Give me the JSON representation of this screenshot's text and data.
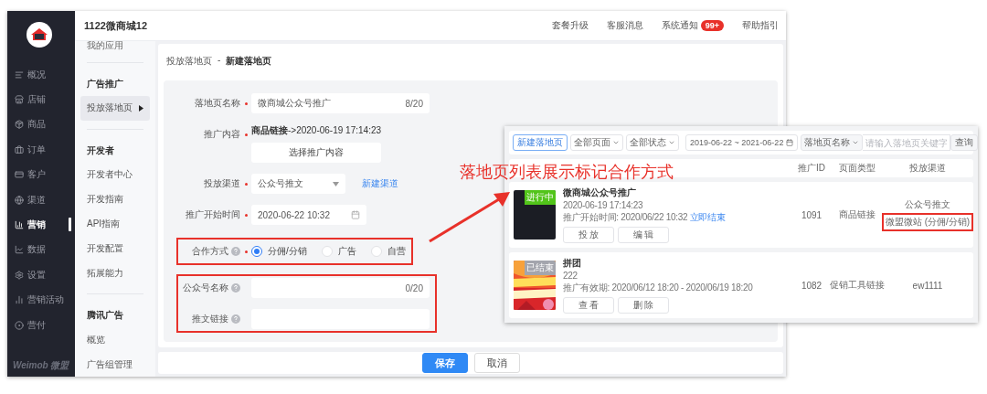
{
  "app": {
    "title": "1122微商城12",
    "brand": "Weimob 微盟"
  },
  "nav": [
    {
      "label": "概况",
      "selected": false
    },
    {
      "label": "店铺",
      "selected": false
    },
    {
      "label": "商品",
      "selected": false
    },
    {
      "label": "订单",
      "selected": false
    },
    {
      "label": "客户",
      "selected": false
    },
    {
      "label": "渠道",
      "selected": false
    },
    {
      "label": "营销",
      "selected": true
    },
    {
      "label": "数据",
      "selected": false
    },
    {
      "label": "设置",
      "selected": false
    },
    {
      "label": "营销活动",
      "selected": false
    },
    {
      "label": "营付",
      "selected": false
    }
  ],
  "top_links": [
    {
      "label": "套餐升级"
    },
    {
      "label": "客服消息"
    },
    {
      "label": "系统通知",
      "badge": "99+"
    },
    {
      "label": "帮助指引"
    }
  ],
  "subnav": {
    "top_item": "我的应用",
    "groups": [
      {
        "title": "广告推广",
        "items": [
          {
            "label": "投放落地页",
            "selected": true
          }
        ]
      },
      {
        "title": "开发者",
        "items": [
          {
            "label": "开发者中心",
            "selected": false
          },
          {
            "label": "开发指南",
            "selected": false
          },
          {
            "label": "API指南",
            "selected": false
          },
          {
            "label": "开发配置",
            "selected": false
          },
          {
            "label": "拓展能力",
            "selected": false
          }
        ]
      },
      {
        "title": "腾讯广告",
        "items": [
          {
            "label": "概览",
            "selected": false
          },
          {
            "label": "广告组管理",
            "selected": false
          }
        ]
      }
    ]
  },
  "breadcrumb": {
    "items": [
      "投放落地页",
      "新建落地页"
    ],
    "separator": "-"
  },
  "form": {
    "sections": [
      {
        "highlighted": false,
        "fields": [
          {
            "kind": "input",
            "label": "落地页名称",
            "required": true,
            "help": false,
            "value": "微商城公众号推广",
            "counter": "8/20"
          },
          {
            "kind": "content",
            "label": "推广内容",
            "required": true,
            "help": false,
            "text": "**商品链接**->2020-06-19 17:14:23",
            "button": "选择推广内容"
          },
          {
            "kind": "select",
            "label": "投放渠道",
            "required": true,
            "help": false,
            "value": "公众号推文",
            "link": "新建渠道"
          },
          {
            "kind": "date",
            "label": "推广开始时间",
            "required": true,
            "help": false,
            "value": "2020-06-22 10:32"
          }
        ]
      },
      {
        "highlighted": true,
        "fields": [
          {
            "kind": "radio",
            "label": "合作方式",
            "required": true,
            "help": true,
            "options": [
              {
                "label": "分佣/分销",
                "selected": true
              },
              {
                "label": "广告",
                "selected": false
              },
              {
                "label": "自营",
                "selected": false
              }
            ]
          }
        ]
      },
      {
        "highlighted": true,
        "fields": [
          {
            "kind": "input",
            "label": "公众号名称",
            "required": false,
            "help": true,
            "counter": "0/20"
          },
          {
            "kind": "input",
            "label": "推文链接",
            "required": false,
            "help": true
          }
        ]
      }
    ]
  },
  "buttons": [
    {
      "label": "保存",
      "primary": true
    },
    {
      "label": "取消",
      "primary": false
    }
  ],
  "annotation": {
    "text": "落地页列表展示标记合作方式"
  },
  "inset": {
    "toolbar": {
      "new_button": "新建落地页",
      "filters": [
        "全部页面",
        "全部状态"
      ],
      "date_from": "2019-06-22",
      "date_sep": "~",
      "date_to": "2021-06-22",
      "search_select": "落地页名称",
      "placeholder": "请输入落地页关键字",
      "query_button": "查询"
    },
    "columns": [
      "推广ID",
      "页面类型",
      "投放渠道"
    ],
    "rows": [
      {
        "thumbnail": {
          "kind": "blank"
        },
        "status": "进行中",
        "color": "#52c41a",
        "title": "微商城公众号推广",
        "line": "2020-06-19 17:14:23",
        "schedule": "推广开始时间: 2020/06/22 10:32",
        "link": "立即结束",
        "actions": [
          "投 放",
          "编 辑"
        ],
        "id": "1091",
        "type": "商品链接",
        "channel": "公众号推文",
        "channel_note": "微盟微站 (分佣/分销)",
        "note_highlighted": true
      },
      {
        "thumbnail": {
          "kind": "picture"
        },
        "status": "已结束",
        "color": "#a3a5ad",
        "title": "拼团",
        "line": "222",
        "schedule": "推广有效期: 2020/06/12 18:20 - 2020/06/19 18:20",
        "actions": [
          "查 看",
          "删 除"
        ],
        "id": "1082",
        "type": "促销工具链接",
        "channel": "ew1111"
      }
    ]
  }
}
